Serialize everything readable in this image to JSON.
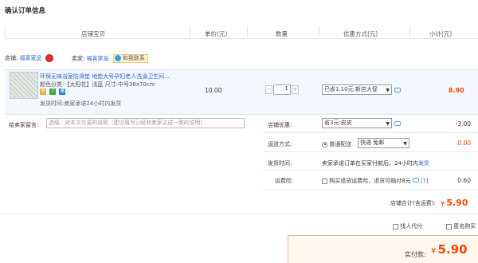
{
  "page": {
    "title": "确认订单信息"
  },
  "columns": [
    "店铺宝贝",
    "单价(元)",
    "数量",
    "优惠方式(元)",
    "小计(元)"
  ],
  "shop": {
    "label": "店铺:",
    "name": "福喜家品",
    "seller_label": "卖家:",
    "seller_name": "福喜家品",
    "contact": "和我联系"
  },
  "item": {
    "title": "环保无味浴室防滑垫 地垫大号孕妇老人洗澡卫生间...",
    "attributes": "颜色分类:【太阳花】浅蓝  尺寸:中号38x70cm",
    "ship_note": "发货时间:卖家承诺24小时内发货",
    "unit_price": "10.00",
    "quantity": "1",
    "qty_minus": "−",
    "qty_plus": "+",
    "discount_option": "已省1.10元:新店大促",
    "subtotal": "8.90",
    "badges": [
      "消",
      "7",
      "聚"
    ]
  },
  "message": {
    "label": "给卖家留言:",
    "placeholder": "选填：对本次交易的说明（建议填写已经和卖家达成一致的说明）"
  },
  "shop_discount": {
    "label": "店铺优惠:",
    "option": "省3元:皮皮",
    "amount": "-3.00"
  },
  "shipping": {
    "label": "运送方式:",
    "radio_label": "普通配送",
    "option": "快递 免邮",
    "amount": "0.00"
  },
  "ship_time": {
    "label": "发货时间:",
    "text": "卖家承诺订单在买家付款后，24小时内",
    "link": "发货"
  },
  "insurance": {
    "label": "运费险:",
    "text": "购买退货运费险，退货可赔付8元",
    "help": "[?]",
    "amount": "0.60"
  },
  "shop_total": {
    "label": "店铺合计(含运费):",
    "currency": "¥",
    "value": "5.90"
  },
  "options": {
    "pay_for_me": "找人代付",
    "anonymous": "匿名购买"
  },
  "payment": {
    "label": "实付款:",
    "currency": "¥",
    "value": "5.90"
  },
  "colors": {
    "accent": "#ff4400",
    "link": "#3366cc",
    "header_rule": "#e0e0e0",
    "item_bg": "#f2f8fd"
  }
}
